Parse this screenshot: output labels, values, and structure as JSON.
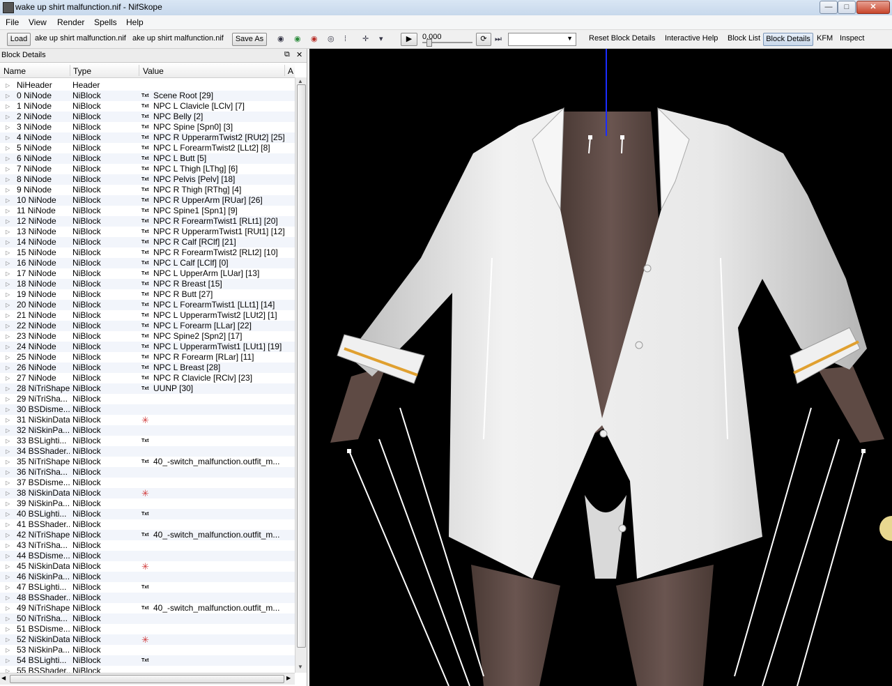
{
  "window": {
    "title": "wake up shirt malfunction.nif - NifSkope",
    "minimize": "—",
    "maximize": "□",
    "close": "✕"
  },
  "menu": [
    "File",
    "View",
    "Render",
    "Spells",
    "Help"
  ],
  "toolbar": {
    "load": "Load",
    "load_path": "ake up shirt malfunction.nif",
    "save_path": "ake up shirt malfunction.nif",
    "save_as": "Save As",
    "time_value": "0.000",
    "reset_block_details": "Reset Block Details",
    "interactive_help": "Interactive Help",
    "block_list": "Block List",
    "block_details": "Block Details",
    "kfm": "KFM",
    "inspect": "Inspect"
  },
  "panel": {
    "title": "Block Details",
    "columns": [
      "Name",
      "Type",
      "Value",
      "A"
    ],
    "rows": [
      {
        "name": "NiHeader",
        "type": "Header",
        "icon": "",
        "value": ""
      },
      {
        "name": "0 NiNode",
        "type": "NiBlock",
        "icon": "Txt",
        "value": "Scene Root [29]"
      },
      {
        "name": "1 NiNode",
        "type": "NiBlock",
        "icon": "Txt",
        "value": "NPC L Clavicle [LClv] [7]"
      },
      {
        "name": "2 NiNode",
        "type": "NiBlock",
        "icon": "Txt",
        "value": "NPC Belly [2]"
      },
      {
        "name": "3 NiNode",
        "type": "NiBlock",
        "icon": "Txt",
        "value": "NPC Spine [Spn0] [3]"
      },
      {
        "name": "4 NiNode",
        "type": "NiBlock",
        "icon": "Txt",
        "value": "NPC R UpperarmTwist2 [RUt2] [25]"
      },
      {
        "name": "5 NiNode",
        "type": "NiBlock",
        "icon": "Txt",
        "value": "NPC L ForearmTwist2 [LLt2] [8]"
      },
      {
        "name": "6 NiNode",
        "type": "NiBlock",
        "icon": "Txt",
        "value": "NPC L Butt [5]"
      },
      {
        "name": "7 NiNode",
        "type": "NiBlock",
        "icon": "Txt",
        "value": "NPC L Thigh [LThg] [6]"
      },
      {
        "name": "8 NiNode",
        "type": "NiBlock",
        "icon": "Txt",
        "value": "NPC Pelvis [Pelv] [18]"
      },
      {
        "name": "9 NiNode",
        "type": "NiBlock",
        "icon": "Txt",
        "value": "NPC R Thigh [RThg] [4]"
      },
      {
        "name": "10 NiNode",
        "type": "NiBlock",
        "icon": "Txt",
        "value": "NPC R UpperArm [RUar] [26]"
      },
      {
        "name": "11 NiNode",
        "type": "NiBlock",
        "icon": "Txt",
        "value": "NPC Spine1 [Spn1] [9]"
      },
      {
        "name": "12 NiNode",
        "type": "NiBlock",
        "icon": "Txt",
        "value": "NPC R ForearmTwist1 [RLt1] [20]"
      },
      {
        "name": "13 NiNode",
        "type": "NiBlock",
        "icon": "Txt",
        "value": "NPC R UpperarmTwist1 [RUt1] [12]"
      },
      {
        "name": "14 NiNode",
        "type": "NiBlock",
        "icon": "Txt",
        "value": "NPC R Calf [RClf] [21]"
      },
      {
        "name": "15 NiNode",
        "type": "NiBlock",
        "icon": "Txt",
        "value": "NPC R ForearmTwist2 [RLt2] [10]"
      },
      {
        "name": "16 NiNode",
        "type": "NiBlock",
        "icon": "Txt",
        "value": "NPC L Calf [LClf] [0]"
      },
      {
        "name": "17 NiNode",
        "type": "NiBlock",
        "icon": "Txt",
        "value": "NPC L UpperArm [LUar] [13]"
      },
      {
        "name": "18 NiNode",
        "type": "NiBlock",
        "icon": "Txt",
        "value": "NPC R Breast [15]"
      },
      {
        "name": "19 NiNode",
        "type": "NiBlock",
        "icon": "Txt",
        "value": "NPC R Butt [27]"
      },
      {
        "name": "20 NiNode",
        "type": "NiBlock",
        "icon": "Txt",
        "value": "NPC L ForearmTwist1 [LLt1] [14]"
      },
      {
        "name": "21 NiNode",
        "type": "NiBlock",
        "icon": "Txt",
        "value": "NPC L UpperarmTwist2 [LUt2] [1]"
      },
      {
        "name": "22 NiNode",
        "type": "NiBlock",
        "icon": "Txt",
        "value": "NPC L Forearm [LLar] [22]"
      },
      {
        "name": "23 NiNode",
        "type": "NiBlock",
        "icon": "Txt",
        "value": "NPC Spine2 [Spn2] [17]"
      },
      {
        "name": "24 NiNode",
        "type": "NiBlock",
        "icon": "Txt",
        "value": "NPC L UpperarmTwist1 [LUt1] [19]"
      },
      {
        "name": "25 NiNode",
        "type": "NiBlock",
        "icon": "Txt",
        "value": "NPC R Forearm [RLar] [11]"
      },
      {
        "name": "26 NiNode",
        "type": "NiBlock",
        "icon": "Txt",
        "value": "NPC L Breast [28]"
      },
      {
        "name": "27 NiNode",
        "type": "NiBlock",
        "icon": "Txt",
        "value": "NPC R Clavicle [RClv] [23]"
      },
      {
        "name": "28 NiTriShape",
        "type": "NiBlock",
        "icon": "Txt",
        "value": "UUNP [30]"
      },
      {
        "name": "29 NiTriSha...",
        "type": "NiBlock",
        "icon": "",
        "value": ""
      },
      {
        "name": "30 BSDisme...",
        "type": "NiBlock",
        "icon": "",
        "value": ""
      },
      {
        "name": "31 NiSkinData",
        "type": "NiBlock",
        "icon": "star",
        "value": ""
      },
      {
        "name": "32 NiSkinPa...",
        "type": "NiBlock",
        "icon": "",
        "value": ""
      },
      {
        "name": "33 BSLighti...",
        "type": "NiBlock",
        "icon": "Txt",
        "value": ""
      },
      {
        "name": "34 BSShader...",
        "type": "NiBlock",
        "icon": "",
        "value": ""
      },
      {
        "name": "35 NiTriShape",
        "type": "NiBlock",
        "icon": "Txt",
        "value": "40_-switch_malfunction.outfit_m..."
      },
      {
        "name": "36 NiTriSha...",
        "type": "NiBlock",
        "icon": "",
        "value": ""
      },
      {
        "name": "37 BSDisme...",
        "type": "NiBlock",
        "icon": "",
        "value": ""
      },
      {
        "name": "38 NiSkinData",
        "type": "NiBlock",
        "icon": "star",
        "value": ""
      },
      {
        "name": "39 NiSkinPa...",
        "type": "NiBlock",
        "icon": "",
        "value": ""
      },
      {
        "name": "40 BSLighti...",
        "type": "NiBlock",
        "icon": "Txt",
        "value": ""
      },
      {
        "name": "41 BSShader...",
        "type": "NiBlock",
        "icon": "",
        "value": ""
      },
      {
        "name": "42 NiTriShape",
        "type": "NiBlock",
        "icon": "Txt",
        "value": "40_-switch_malfunction.outfit_m..."
      },
      {
        "name": "43 NiTriSha...",
        "type": "NiBlock",
        "icon": "",
        "value": ""
      },
      {
        "name": "44 BSDisme...",
        "type": "NiBlock",
        "icon": "",
        "value": ""
      },
      {
        "name": "45 NiSkinData",
        "type": "NiBlock",
        "icon": "star",
        "value": ""
      },
      {
        "name": "46 NiSkinPa...",
        "type": "NiBlock",
        "icon": "",
        "value": ""
      },
      {
        "name": "47 BSLighti...",
        "type": "NiBlock",
        "icon": "Txt",
        "value": ""
      },
      {
        "name": "48 BSShader...",
        "type": "NiBlock",
        "icon": "",
        "value": ""
      },
      {
        "name": "49 NiTriShape",
        "type": "NiBlock",
        "icon": "Txt",
        "value": "40_-switch_malfunction.outfit_m..."
      },
      {
        "name": "50 NiTriSha...",
        "type": "NiBlock",
        "icon": "",
        "value": ""
      },
      {
        "name": "51 BSDisme...",
        "type": "NiBlock",
        "icon": "",
        "value": ""
      },
      {
        "name": "52 NiSkinData",
        "type": "NiBlock",
        "icon": "star",
        "value": ""
      },
      {
        "name": "53 NiSkinPa...",
        "type": "NiBlock",
        "icon": "",
        "value": ""
      },
      {
        "name": "54 BSLighti...",
        "type": "NiBlock",
        "icon": "Txt",
        "value": ""
      },
      {
        "name": "55 BSShader...",
        "type": "NiBlock",
        "icon": "",
        "value": ""
      }
    ]
  },
  "colors": {
    "viewport_bg": "#000000",
    "shirt": "#e4e4e4",
    "skin": "#5e4a44",
    "cuff_stripe": "#e0a030",
    "axis_blue": "#1a2cff"
  }
}
